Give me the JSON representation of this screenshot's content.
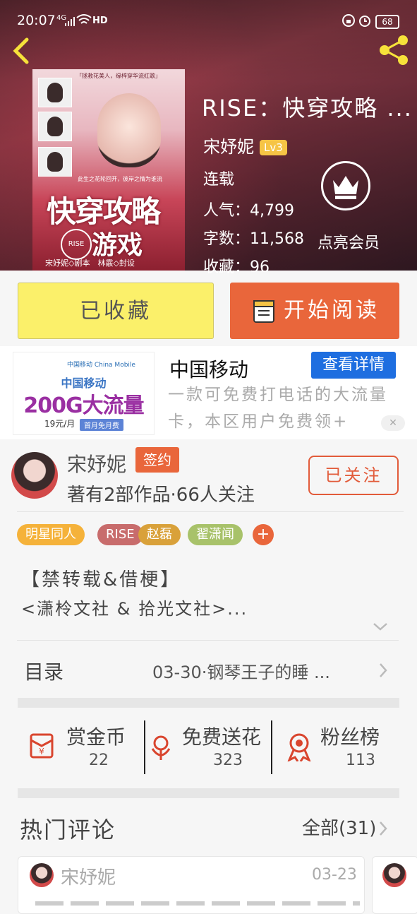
{
  "status_bar": {
    "time": "20:07",
    "network": "4G",
    "hd": "HD",
    "battery": "68"
  },
  "book": {
    "title": "RISE：快穿攻略 ...",
    "author": "宋妤妮",
    "level": "Lv3",
    "status": "连载",
    "popularity": "人气：4,799",
    "word_count": "字数：11,568",
    "favorites": "收藏：96",
    "vip_label": "点亮会员",
    "cover": {
      "tagline": "「拯救花美人，缘梓穿华流红歌」",
      "tagline2": "此生之花轮回开，彼岸之情为谁流",
      "title_line1": "快穿攻略",
      "title_line2": "游戏",
      "seal": "RISE",
      "credit": "宋妤妮◇剧本　林霰◇封设"
    }
  },
  "actions": {
    "favorited_label": "已收藏",
    "read_label": "开始阅读"
  },
  "ad": {
    "image": {
      "logo": "中国移动 China Mobile",
      "line1": "中国移动",
      "line2": "200G大流量",
      "price": "19元/月",
      "promo": "首月免月费"
    },
    "title": "中国移动",
    "detail_button": "查看详情",
    "description": "一款可免费打电话的大流量卡，本区用户免费领+",
    "close": "✕"
  },
  "author_card": {
    "name": "宋妤妮",
    "badge": "签约",
    "stats": "著有2部作品·66人关注",
    "follow_label": "已关注"
  },
  "tags": [
    {
      "label": "明星同人",
      "color": "#f5b23a"
    },
    {
      "label": "RISE",
      "color": "#c86c6c"
    },
    {
      "label": "赵磊",
      "color": "#d9a13a"
    },
    {
      "label": "翟潇闻",
      "color": "#a8c26a"
    }
  ],
  "tag_more": "+",
  "description": {
    "line1": "【禁转载&借梗】",
    "line2": "<潇柃文社 & 拾光文社>..."
  },
  "toc": {
    "label": "目录",
    "latest": "03-30·钢琴王子的睡 ..."
  },
  "stats": [
    {
      "label": "赏金币",
      "value": "22"
    },
    {
      "label": "免费送花",
      "value": "323"
    },
    {
      "label": "粉丝榜",
      "value": "113"
    }
  ],
  "hot_comments": {
    "title": "热门评论",
    "all_label": "全部(31)",
    "first": {
      "name": "宋妤妮",
      "date": "03-23"
    }
  },
  "colors": {
    "accent_orange": "#e9663b",
    "fav_yellow": "#fbf06a",
    "ad_blue": "#1e6ee0"
  }
}
